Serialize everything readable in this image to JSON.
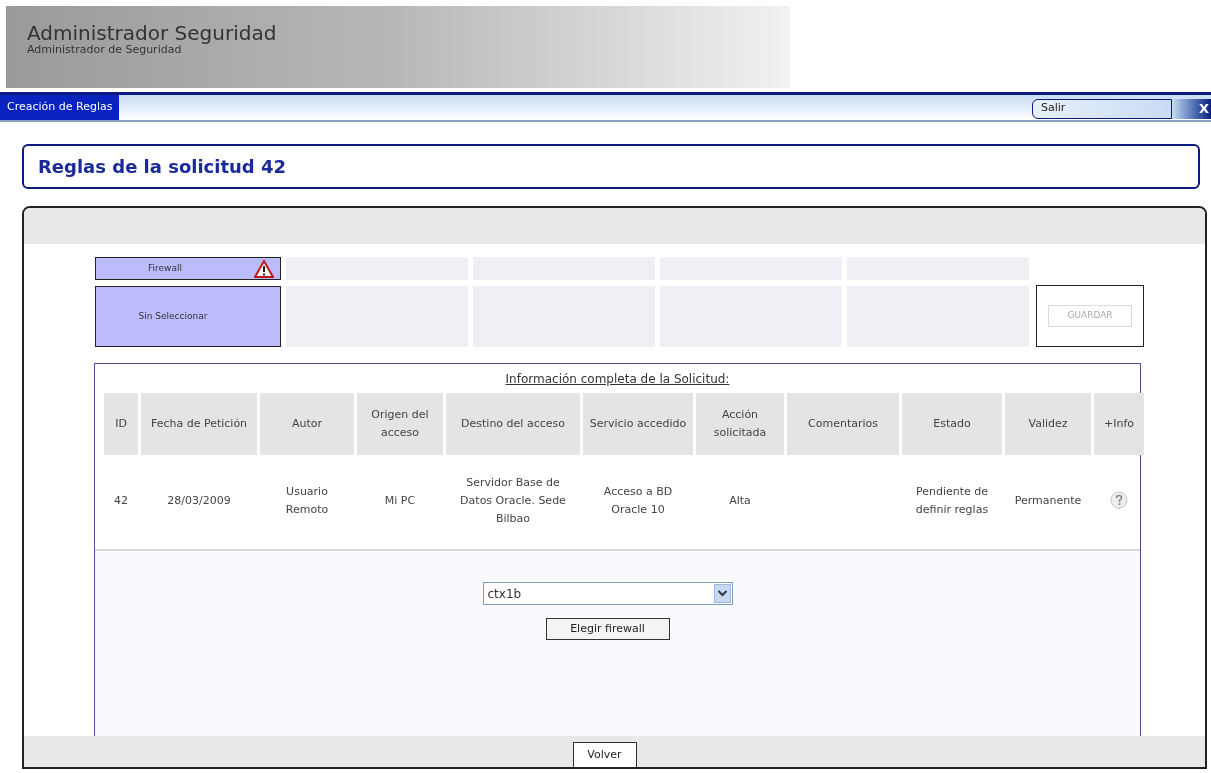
{
  "header": {
    "title": "Administrador Seguridad",
    "subtitle": "Administrador de Seguridad"
  },
  "nav": {
    "tabs": [
      {
        "label": "Creación de Reglas",
        "selected": true
      }
    ],
    "logout": {
      "label": "Salir",
      "close": "X"
    }
  },
  "page_title": "Reglas de la solicitud 42",
  "stage": {
    "label": "Firewall",
    "warning": true,
    "value": "Sin Seleccionar",
    "selected": true
  },
  "save_button": {
    "label": "GUARDAR",
    "disabled": true
  },
  "info": {
    "caption": "Información completa de la Solicitud:",
    "columns": [
      "ID",
      "Fecha de Petición",
      "Autor",
      "Origen del acceso",
      "Destino del acceso",
      "Servicio accedido",
      "Acción solicitada",
      "Comentarios",
      "Estado",
      "Validez",
      "+Info"
    ],
    "rows": [
      {
        "cells": [
          "42",
          "28/03/2009",
          "Usuario Remoto",
          "Mi PC",
          "Servidor Base de Datos Oracle. Sede Bilbao",
          "Acceso a BD Oracle 10",
          "Alta",
          "",
          "Pendiente de definir reglas",
          "Permanente"
        ],
        "info_icon": true
      }
    ]
  },
  "firewall_select": {
    "value": "ctx1b"
  },
  "choose_button": "Elegir firewall",
  "back_button": "Volver"
}
